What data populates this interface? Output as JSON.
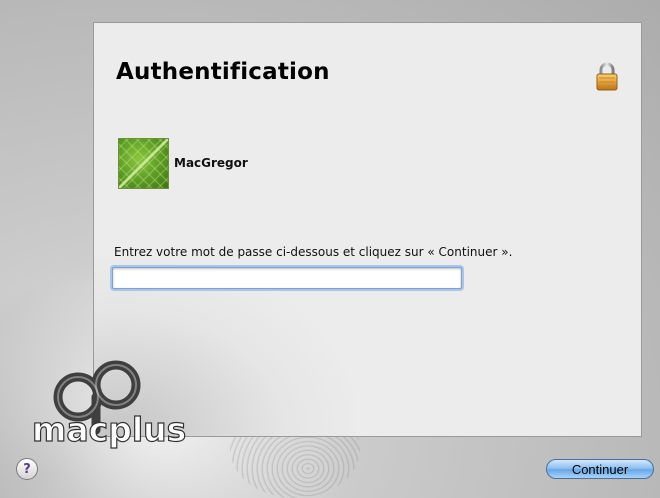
{
  "dialog": {
    "title": "Authentification",
    "user_name": "MacGregor",
    "prompt": "Entrez votre mot de passe ci-dessous et cliquez sur « Continuer ».",
    "password": {
      "value": "",
      "placeholder": ""
    }
  },
  "branding": {
    "logo_text": "macplus"
  },
  "buttons": {
    "help_label": "?",
    "continue_label": "Continuer"
  },
  "icons": {
    "lock": "lock-icon",
    "help": "help-icon",
    "user": "user-picture-leaf"
  },
  "colors": {
    "accent_blue": "#6aa7e6",
    "focus_ring": "#a8c6ec",
    "lock_gold": "#e5a23a",
    "leaf_green": "#5a9a22"
  }
}
